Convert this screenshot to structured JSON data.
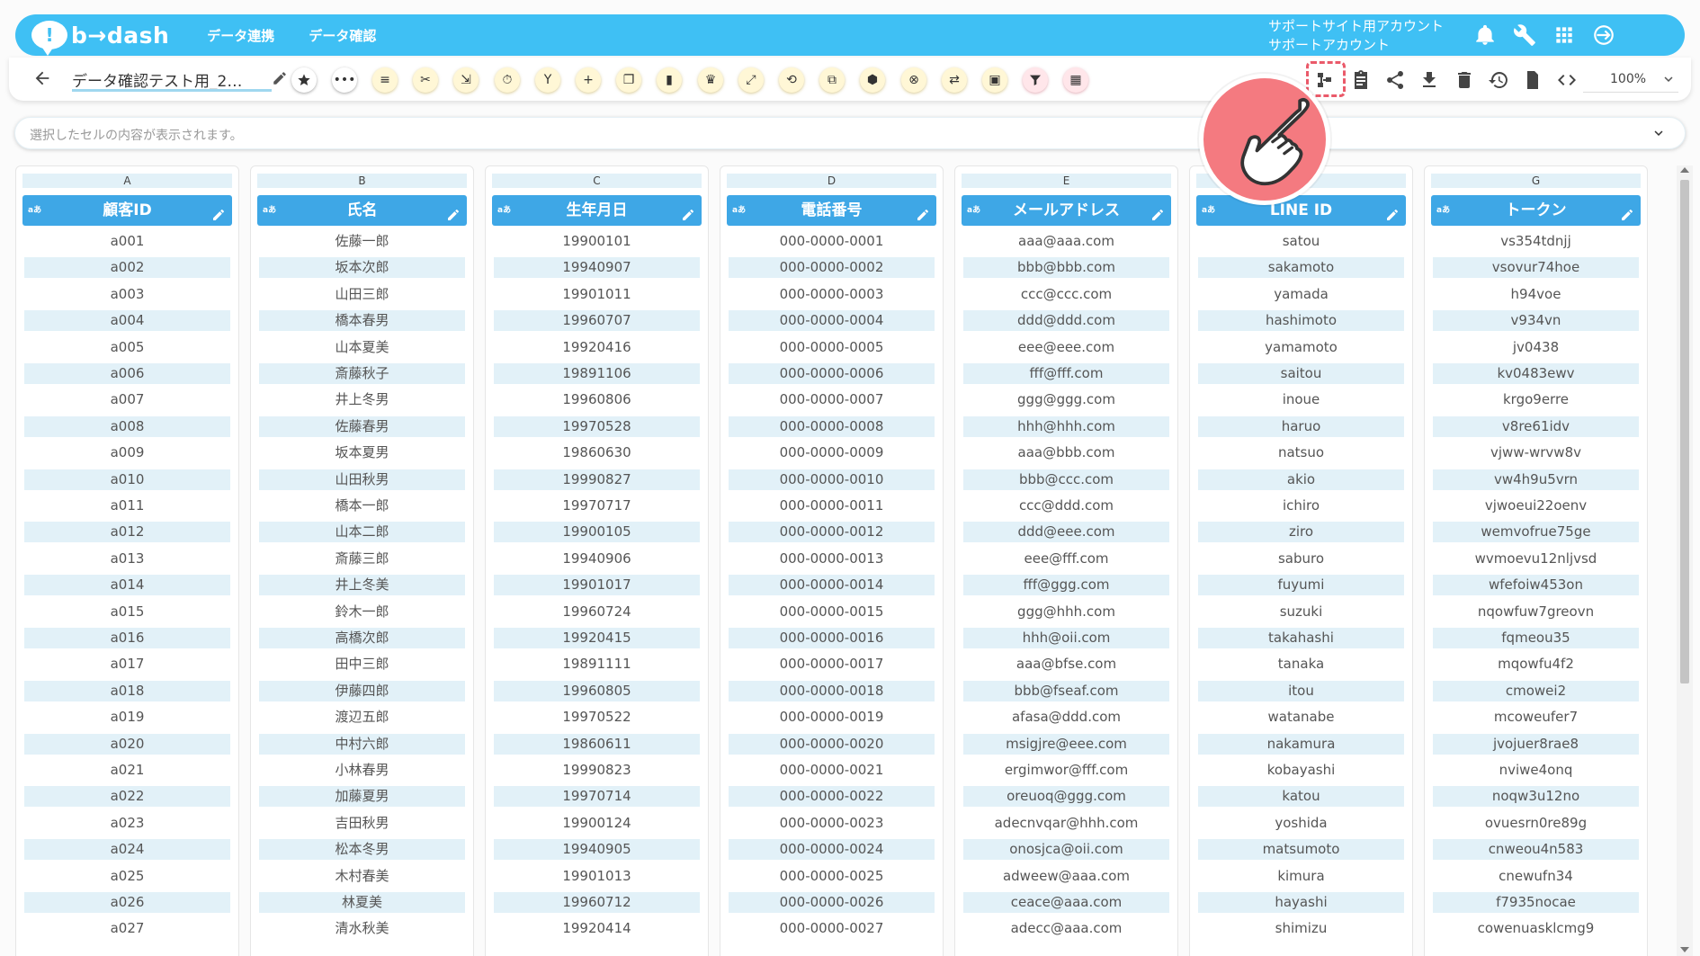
{
  "header": {
    "logo": "b→dash",
    "nav": [
      "データ連携",
      "データ確認"
    ],
    "account_line1": "サポートサイト用アカウント",
    "account_line2": "サポートアカウント",
    "accent_color": "#3fc0f4"
  },
  "toolbar": {
    "title": "データ確認テスト用_2…",
    "zoom": "100%"
  },
  "formula": {
    "placeholder": "選択したセルの内容が表示されます。"
  },
  "columns": [
    {
      "letter": "A",
      "header": "顧客ID",
      "type": "aあ"
    },
    {
      "letter": "B",
      "header": "氏名",
      "type": "aあ"
    },
    {
      "letter": "C",
      "header": "生年月日",
      "type": "aあ"
    },
    {
      "letter": "D",
      "header": "電話番号",
      "type": "aあ"
    },
    {
      "letter": "E",
      "header": "メールアドレス",
      "type": "aあ"
    },
    {
      "letter": "F",
      "header": "LINE ID",
      "type": "aあ"
    },
    {
      "letter": "G",
      "header": "トークン",
      "type": "aあ"
    }
  ],
  "rows": [
    [
      "a001",
      "佐藤一郎",
      "19900101",
      "000-0000-0001",
      "aaa@aaa.com",
      "satou",
      "vs354tdnjj"
    ],
    [
      "a002",
      "坂本次郎",
      "19940907",
      "000-0000-0002",
      "bbb@bbb.com",
      "sakamoto",
      "vsovur74hoe"
    ],
    [
      "a003",
      "山田三郎",
      "19901011",
      "000-0000-0003",
      "ccc@ccc.com",
      "yamada",
      "h94voe"
    ],
    [
      "a004",
      "橋本春男",
      "19960707",
      "000-0000-0004",
      "ddd@ddd.com",
      "hashimoto",
      "v934vn"
    ],
    [
      "a005",
      "山本夏美",
      "19920416",
      "000-0000-0005",
      "eee@eee.com",
      "yamamoto",
      "jv0438"
    ],
    [
      "a006",
      "斎藤秋子",
      "19891106",
      "000-0000-0006",
      "fff@fff.com",
      "saitou",
      "kv0483ewv"
    ],
    [
      "a007",
      "井上冬男",
      "19960806",
      "000-0000-0007",
      "ggg@ggg.com",
      "inoue",
      "krgo9erre"
    ],
    [
      "a008",
      "佐藤春男",
      "19970528",
      "000-0000-0008",
      "hhh@hhh.com",
      "haruo",
      "v8re61idv"
    ],
    [
      "a009",
      "坂本夏男",
      "19860630",
      "000-0000-0009",
      "aaa@bbb.com",
      "natsuo",
      "vjww-wrvw8v"
    ],
    [
      "a010",
      "山田秋男",
      "19990827",
      "000-0000-0010",
      "bbb@ccc.com",
      "akio",
      "vw4h9u5vrn"
    ],
    [
      "a011",
      "橋本一郎",
      "19970717",
      "000-0000-0011",
      "ccc@ddd.com",
      "ichiro",
      "vjwoeui22oenv"
    ],
    [
      "a012",
      "山本二郎",
      "19900105",
      "000-0000-0012",
      "ddd@eee.com",
      "ziro",
      "wemvofrue75ge"
    ],
    [
      "a013",
      "斎藤三郎",
      "19940906",
      "000-0000-0013",
      "eee@fff.com",
      "saburo",
      "wvmoevu12nljvsd"
    ],
    [
      "a014",
      "井上冬美",
      "19901017",
      "000-0000-0014",
      "fff@ggg.com",
      "fuyumi",
      "wfefoiw453on"
    ],
    [
      "a015",
      "鈴木一郎",
      "19960724",
      "000-0000-0015",
      "ggg@hhh.com",
      "suzuki",
      "nqowfuw7greovn"
    ],
    [
      "a016",
      "高橋次郎",
      "19920415",
      "000-0000-0016",
      "hhh@oii.com",
      "takahashi",
      "fqmeou35"
    ],
    [
      "a017",
      "田中三郎",
      "19891111",
      "000-0000-0017",
      "aaa@bfse.com",
      "tanaka",
      "mqowfu4f2"
    ],
    [
      "a018",
      "伊藤四郎",
      "19960805",
      "000-0000-0018",
      "bbb@fseaf.com",
      "itou",
      "cmowei2"
    ],
    [
      "a019",
      "渡辺五郎",
      "19970522",
      "000-0000-0019",
      "afasa@ddd.com",
      "watanabe",
      "mcoweufer7"
    ],
    [
      "a020",
      "中村六郎",
      "19860611",
      "000-0000-0020",
      "msigjre@eee.com",
      "nakamura",
      "jvojuer8rae8"
    ],
    [
      "a021",
      "小林春男",
      "19990823",
      "000-0000-0021",
      "ergimwor@fff.com",
      "kobayashi",
      "nviwe4onq"
    ],
    [
      "a022",
      "加藤夏男",
      "19970714",
      "000-0000-0022",
      "oreuoq@ggg.com",
      "katou",
      "noqw3u12no"
    ],
    [
      "a023",
      "吉田秋男",
      "19900124",
      "000-0000-0023",
      "adecnvqar@hhh.com",
      "yoshida",
      "ovuesrn0re89g"
    ],
    [
      "a024",
      "松本冬男",
      "19940905",
      "000-0000-0024",
      "onosjca@oii.com",
      "matsumoto",
      "cnweou4n583"
    ],
    [
      "a025",
      "木村春美",
      "19901013",
      "000-0000-0025",
      "adweew@aaa.com",
      "kimura",
      "cnewufn34"
    ],
    [
      "a026",
      "林夏美",
      "19960712",
      "000-0000-0026",
      "ceace@aaa.com",
      "hayashi",
      "f7935nocae"
    ],
    [
      "a027",
      "清水秋美",
      "19920414",
      "000-0000-0027",
      "adecc@aaa.com",
      "shimizu",
      "cowenuasklcmg9"
    ]
  ]
}
